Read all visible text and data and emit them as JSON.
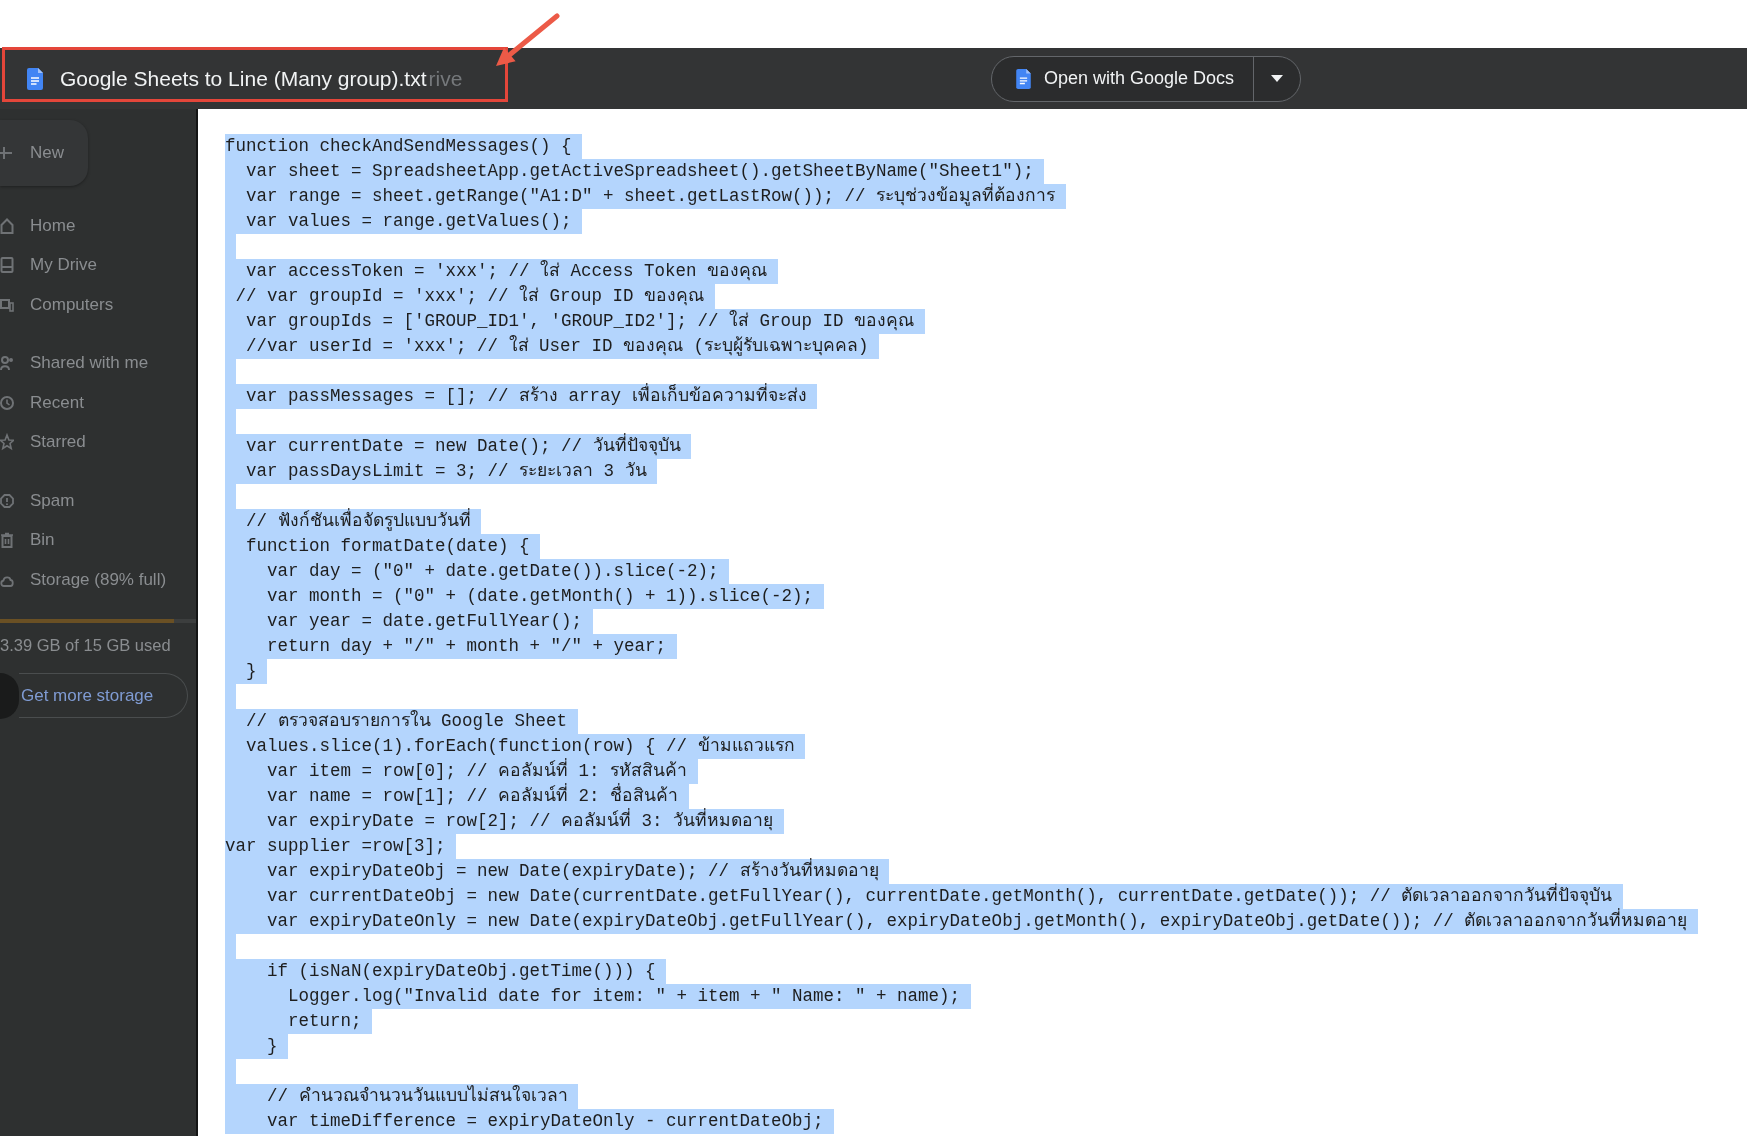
{
  "header": {
    "file_title": "Google Sheets to Line (Many group).txt",
    "background_text": "rive",
    "open_with": {
      "label": "Open with Google Docs"
    }
  },
  "sidebar": {
    "new_button": {
      "label": "New"
    },
    "sections": [
      {
        "items": [
          {
            "label": "Home"
          },
          {
            "label": "My Drive"
          },
          {
            "label": "Computers"
          }
        ]
      },
      {
        "items": [
          {
            "label": "Shared with me"
          },
          {
            "label": "Recent"
          },
          {
            "label": "Starred"
          }
        ]
      },
      {
        "items": [
          {
            "label": "Spam"
          },
          {
            "label": "Bin"
          },
          {
            "label": "Storage (89% full)"
          }
        ]
      }
    ],
    "storage": {
      "level": 0.89,
      "usage": "3.39 GB of 15 GB used",
      "button": {
        "label": "Get more storage"
      }
    }
  },
  "document": {
    "lines": [
      {
        "kind": "code",
        "text": "function checkAndSendMessages() {"
      },
      {
        "kind": "code",
        "text": "  var sheet = SpreadsheetApp.getActiveSpreadsheet().getSheetByName(\"Sheet1\");"
      },
      {
        "kind": "code",
        "text": "  var range = sheet.getRange(\"A1:D\" + sheet.getLastRow()); // ระบุช่วงข้อมูลที่ต้องการ"
      },
      {
        "kind": "code",
        "text": "  var values = range.getValues();"
      },
      {
        "kind": "blank"
      },
      {
        "kind": "code",
        "text": "  var accessToken = 'xxx'; // ใส่ Access Token ของคุณ"
      },
      {
        "kind": "code",
        "text": " // var groupId = 'xxx'; // ใส่ Group ID ของคุณ"
      },
      {
        "kind": "code",
        "text": "  var groupIds = ['GROUP_ID1', 'GROUP_ID2']; // ใส่ Group ID ของคุณ"
      },
      {
        "kind": "code",
        "text": "  //var userId = 'xxx'; // ใส่ User ID ของคุณ (ระบุผู้รับเฉพาะบุคคล)"
      },
      {
        "kind": "blank"
      },
      {
        "kind": "code",
        "text": "  var passMessages = []; // สร้าง array เพื่อเก็บข้อความที่จะส่ง"
      },
      {
        "kind": "blank"
      },
      {
        "kind": "code",
        "text": "  var currentDate = new Date(); // วันที่ปัจจุบัน"
      },
      {
        "kind": "code",
        "text": "  var passDaysLimit = 3; // ระยะเวลา 3 วัน"
      },
      {
        "kind": "blank"
      },
      {
        "kind": "code",
        "text": "  // ฟังก์ชันเพื่อจัดรูปแบบวันที่"
      },
      {
        "kind": "code",
        "text": "  function formatDate(date) {"
      },
      {
        "kind": "code",
        "text": "    var day = (\"0\" + date.getDate()).slice(-2);"
      },
      {
        "kind": "code",
        "text": "    var month = (\"0\" + (date.getMonth() + 1)).slice(-2);"
      },
      {
        "kind": "code",
        "text": "    var year = date.getFullYear();"
      },
      {
        "kind": "code",
        "text": "    return day + \"/\" + month + \"/\" + year;"
      },
      {
        "kind": "code",
        "text": "  }"
      },
      {
        "kind": "blank"
      },
      {
        "kind": "code",
        "text": "  // ตรวจสอบรายการใน Google Sheet"
      },
      {
        "kind": "code",
        "text": "  values.slice(1).forEach(function(row) { // ข้ามแถวแรก"
      },
      {
        "kind": "code",
        "text": "    var item = row[0]; // คอลัมน์ที่ 1: รหัสสินค้า"
      },
      {
        "kind": "code",
        "text": "    var name = row[1]; // คอลัมน์ที่ 2: ชื่อสินค้า"
      },
      {
        "kind": "code",
        "text": "    var expiryDate = row[2]; // คอลัมน์ที่ 3: วันที่หมดอายุ"
      },
      {
        "kind": "code",
        "text": "var supplier =row[3];"
      },
      {
        "kind": "code",
        "text": "    var expiryDateObj = new Date(expiryDate); // สร้างวันที่หมดอายุ"
      },
      {
        "kind": "code",
        "text": "    var currentDateObj = new Date(currentDate.getFullYear(), currentDate.getMonth(), currentDate.getDate()); // ตัดเวลาออกจากวันที่ปัจจุบัน"
      },
      {
        "kind": "code",
        "text": "    var expiryDateOnly = new Date(expiryDateObj.getFullYear(), expiryDateObj.getMonth(), expiryDateObj.getDate()); // ตัดเวลาออกจากวันที่หมดอายุ"
      },
      {
        "kind": "blank"
      },
      {
        "kind": "code",
        "text": "    if (isNaN(expiryDateObj.getTime())) {"
      },
      {
        "kind": "code",
        "text": "      Logger.log(\"Invalid date for item: \" + item + \" Name: \" + name);"
      },
      {
        "kind": "code",
        "text": "      return;"
      },
      {
        "kind": "code",
        "text": "    }"
      },
      {
        "kind": "blank"
      },
      {
        "kind": "code",
        "text": "    // คำนวณจำนวนวันแบบไม่สนใจเวลา"
      },
      {
        "kind": "code",
        "text": "    var timeDifference = expiryDateOnly - currentDateObj;"
      }
    ]
  }
}
